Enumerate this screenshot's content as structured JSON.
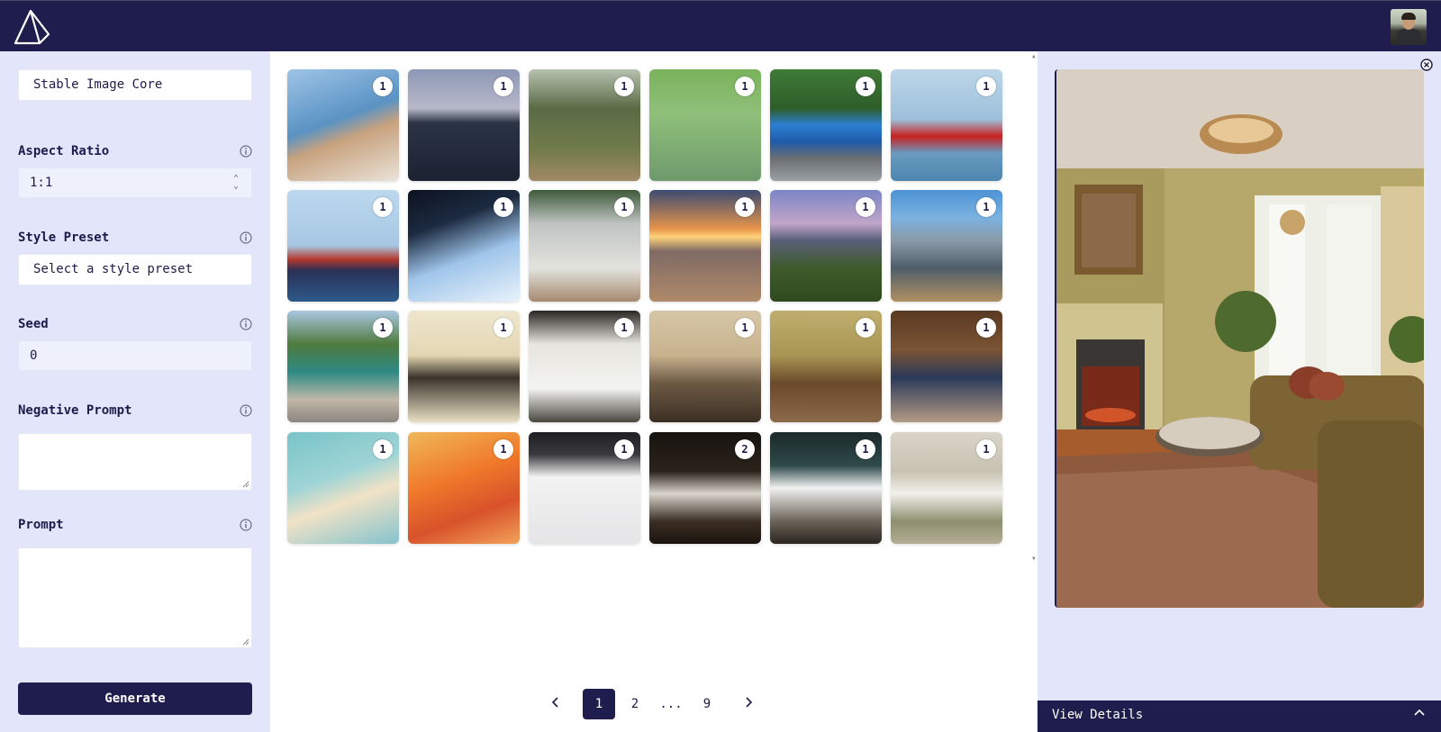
{
  "header": {
    "logo_icon": "prism-triangle-logo",
    "avatar_icon": "user-avatar"
  },
  "sidebar": {
    "model": "Stable Image Core",
    "aspect_ratio": {
      "label": "Aspect Ratio",
      "value": "1:1"
    },
    "style_preset": {
      "label": "Style Preset",
      "value": "Select a style preset"
    },
    "seed": {
      "label": "Seed",
      "value": "0"
    },
    "negative_prompt": {
      "label": "Negative Prompt",
      "value": ""
    },
    "prompt": {
      "label": "Prompt",
      "value": ""
    },
    "generate_label": "Generate"
  },
  "gallery": {
    "tiles": [
      {
        "subject": "balcony-sea-view",
        "count": "1"
      },
      {
        "subject": "lake-dusk",
        "count": "1"
      },
      {
        "subject": "forest-path",
        "count": "1"
      },
      {
        "subject": "rice-field",
        "count": "1"
      },
      {
        "subject": "blue-bus",
        "count": "1"
      },
      {
        "subject": "red-boat",
        "count": "1"
      },
      {
        "subject": "cargo-ship",
        "count": "1"
      },
      {
        "subject": "spaceship-earth",
        "count": "1"
      },
      {
        "subject": "bus-shelter",
        "count": "1"
      },
      {
        "subject": "beach-sunset",
        "count": "1"
      },
      {
        "subject": "mountain-valley",
        "count": "1"
      },
      {
        "subject": "mountain-peak",
        "count": "1"
      },
      {
        "subject": "street-bus-stop",
        "count": "1"
      },
      {
        "subject": "kitchen",
        "count": "1"
      },
      {
        "subject": "modern-kitchen",
        "count": "1"
      },
      {
        "subject": "living-room",
        "count": "1"
      },
      {
        "subject": "classic-living-room",
        "count": "1"
      },
      {
        "subject": "luxury-lounge",
        "count": "1"
      },
      {
        "subject": "paper-planes-sky",
        "count": "1"
      },
      {
        "subject": "paper-planes-clouds",
        "count": "1"
      },
      {
        "subject": "two-white-cats",
        "count": "1"
      },
      {
        "subject": "cat-dark",
        "count": "2"
      },
      {
        "subject": "cat-rock",
        "count": "1"
      },
      {
        "subject": "cat-outdoor",
        "count": "1"
      }
    ]
  },
  "pagination": {
    "prev_icon": "chevron-left-icon",
    "pages": [
      "1",
      "2",
      "...",
      "9"
    ],
    "current": "1",
    "next_icon": "chevron-right-icon"
  },
  "preview": {
    "subject": "classic-living-room-fireplace",
    "close_icon": "close-circle-icon",
    "details_label": "View Details",
    "details_icon": "chevron-up-icon"
  },
  "colors": {
    "navy": "#1f1d4d",
    "panel": "#e3e6fb",
    "white": "#ffffff"
  }
}
